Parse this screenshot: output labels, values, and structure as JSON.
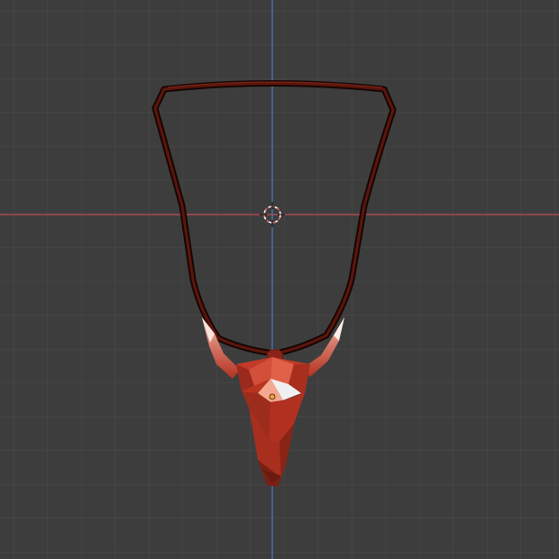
{
  "viewport": {
    "view": "front-orthographic",
    "grid": true,
    "colors": {
      "background": "#3d3d3d",
      "grid_line": "#4a4a4a",
      "axis_x": "#c1525a",
      "axis_z": "#4a7fbd",
      "cursor_red": "#e06060",
      "cursor_white": "#ffffff",
      "cord": "#3a0c08",
      "pendant_base": "#b33222",
      "horn_tip": "#f4dcd0",
      "origin_point": "#f2a23a"
    }
  },
  "scene": {
    "objects": [
      {
        "name": "necklace-cord",
        "type": "mesh"
      },
      {
        "name": "bull-skull-pendant",
        "type": "mesh",
        "shading": "low-poly"
      }
    ],
    "cursor_icon": "3d-cursor-icon",
    "origin_icon": "object-origin-icon"
  }
}
